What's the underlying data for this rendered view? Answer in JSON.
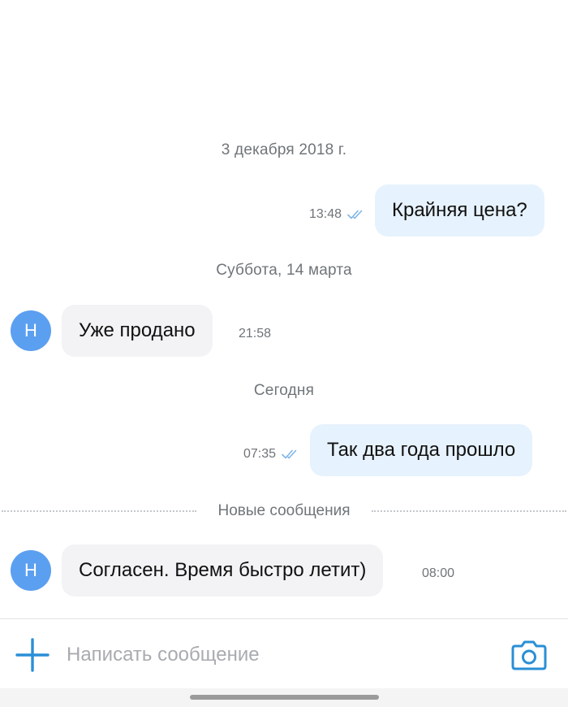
{
  "chat": {
    "separators": {
      "date1": "3 декабря 2018 г.",
      "date2": "Суббота, 14 марта",
      "date3": "Сегодня",
      "new_messages": "Новые сообщения"
    },
    "messages": [
      {
        "direction": "outgoing",
        "text": "Крайняя цена?",
        "time": "13:48",
        "status": "read"
      },
      {
        "direction": "incoming",
        "avatar_letter": "Н",
        "text": "Уже продано",
        "time": "21:58"
      },
      {
        "direction": "outgoing",
        "text": "Так два года прошло",
        "time": "07:35",
        "status": "read"
      },
      {
        "direction": "incoming",
        "avatar_letter": "Н",
        "text": "Согласен. Время быстро летит)",
        "time": "08:00"
      }
    ]
  },
  "composer": {
    "placeholder": "Написать сообщение",
    "value": "",
    "attach_icon": "plus-icon",
    "camera_icon": "camera-icon"
  },
  "colors": {
    "accent": "#2a8fd6",
    "outgoing_bubble": "#e6f2fd",
    "incoming_bubble": "#f3f3f5",
    "avatar": "#5b9ff0",
    "read_checks": "#7fb6e8"
  }
}
